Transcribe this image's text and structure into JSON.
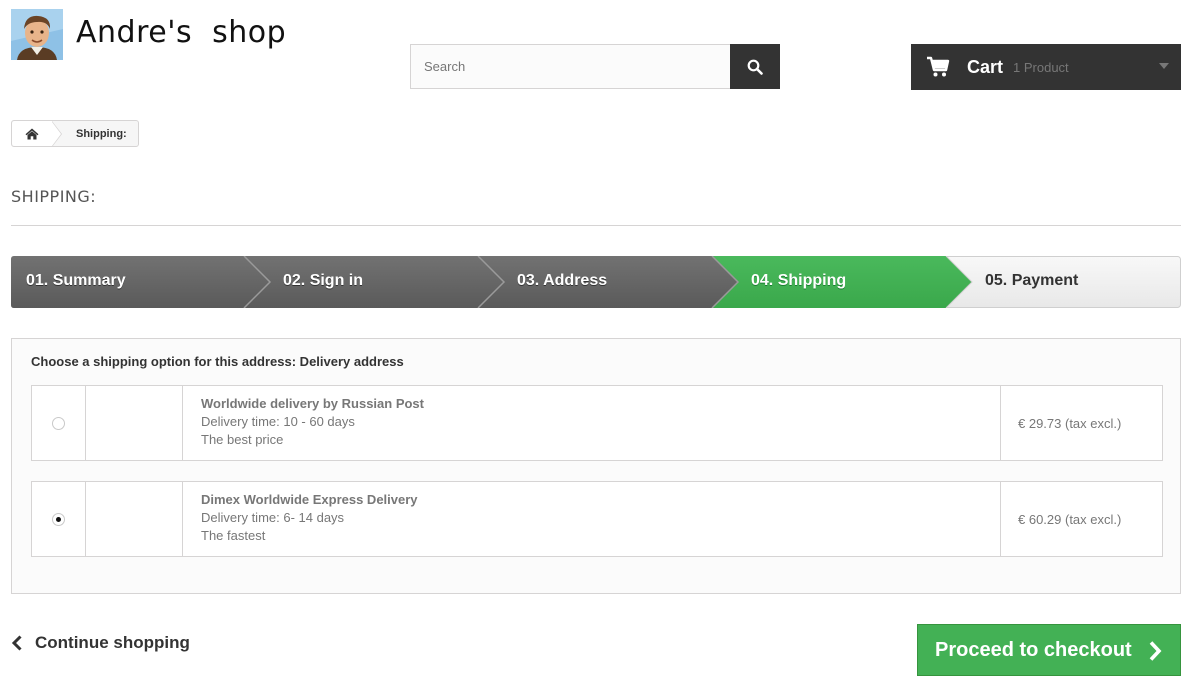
{
  "header": {
    "shop_name": "Andre's  shop",
    "search_placeholder": "Search",
    "cart_label": "Cart",
    "cart_count": "1 Product"
  },
  "breadcrumb": {
    "current": "Shipping:"
  },
  "page": {
    "heading": "SHIPPING:"
  },
  "steps": [
    {
      "label": "01. Summary",
      "state": "done"
    },
    {
      "label": "02. Sign in",
      "state": "done"
    },
    {
      "label": "03. Address",
      "state": "done"
    },
    {
      "label": "04. Shipping",
      "state": "current"
    },
    {
      "label": "05. Payment",
      "state": "upcoming"
    }
  ],
  "delivery": {
    "intro": "Choose a shipping option for this address: Delivery address",
    "options": [
      {
        "name": "Worldwide delivery by Russian Post",
        "time": "Delivery time: 10 - 60 days",
        "note": "The best price",
        "price": "€ 29.73 (tax excl.)",
        "selected": false
      },
      {
        "name": "Dimex Worldwide Express Delivery",
        "time": "Delivery time: 6- 14 days",
        "note": "The fastest",
        "price": "€ 60.29 (tax excl.)",
        "selected": true
      }
    ]
  },
  "footer": {
    "continue_label": "Continue shopping",
    "checkout_label": "Proceed to checkout"
  },
  "colors": {
    "done_step": "#666666",
    "current_step": "#43b155",
    "upcoming_step": "#f3f3f3",
    "dark": "#333333"
  }
}
